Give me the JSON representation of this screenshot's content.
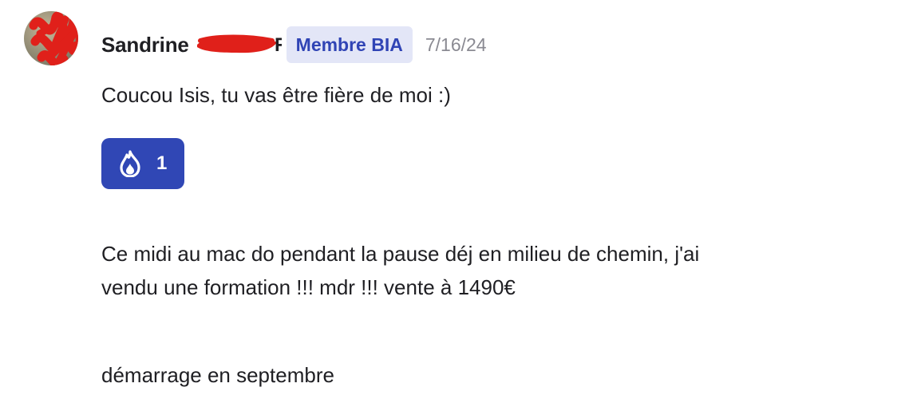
{
  "message": {
    "author": "Sandrine",
    "badge": "Membre BIA",
    "timestamp": "7/16/24",
    "lines": [
      "Coucou Isis, tu vas être fière de moi :)",
      "Ce midi au mac do pendant la pause déj en milieu de chemin, j'ai",
      "vendu une formation !!! mdr !!! vente à 1490€",
      "démarrage en septembre"
    ],
    "reaction": {
      "icon": "flame-icon",
      "count": "1",
      "color": "#3047b5"
    }
  },
  "colors": {
    "badge_bg": "#e3e6f7",
    "badge_text": "#3044b5",
    "redaction": "#e0201a",
    "timestamp": "#8a8a92"
  }
}
